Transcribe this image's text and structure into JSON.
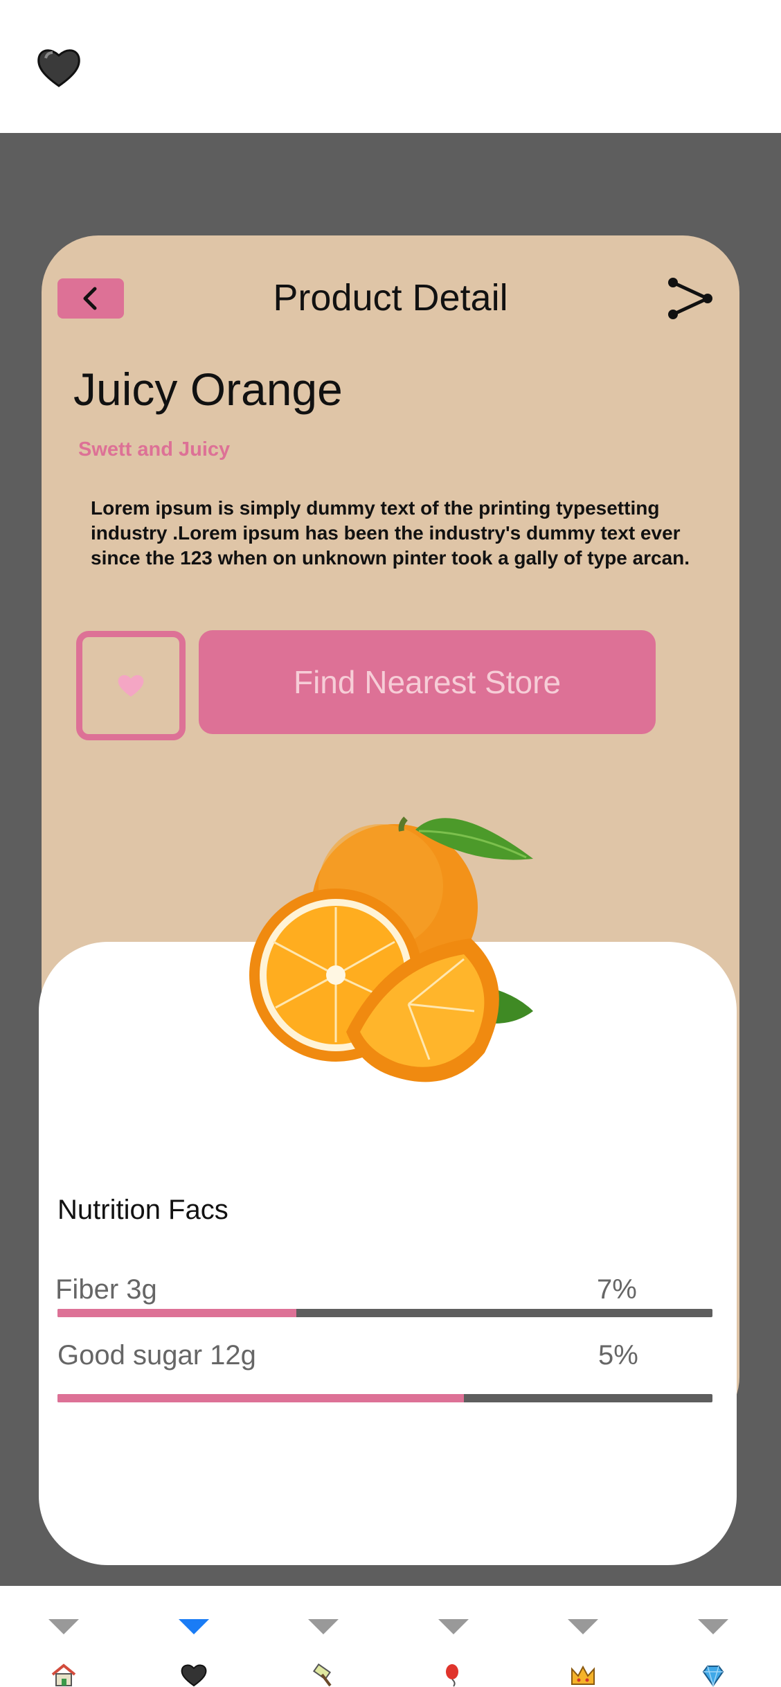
{
  "header": {
    "title": "Product Detail"
  },
  "product": {
    "name": "Juicy Orange",
    "subtitle": "Swett and Juicy",
    "description": "Lorem ipsum is simply dummy text of the printing typesetting industry .Lorem ipsum has been the industry's dummy text ever since the 123 when on unknown pinter took a gally of type arcan."
  },
  "actions": {
    "find_store_label": "Find Nearest Store"
  },
  "nutrition": {
    "title": "Nutrition Facs",
    "items": [
      {
        "name": "Fiber   3g",
        "percent_label": "7%",
        "bar_fill": 0.365
      },
      {
        "name": "Good sugar  12g",
        "percent_label": "5%",
        "bar_fill": 0.62
      }
    ]
  },
  "colors": {
    "accent": "#dd7196",
    "card": "#dfc5a7",
    "backdrop": "#5e5e5e",
    "active_nav": "#1a7cf5"
  },
  "nav": {
    "items": [
      {
        "icon": "home-icon",
        "active": false
      },
      {
        "icon": "heart-icon",
        "active": true
      },
      {
        "icon": "hammer-icon",
        "active": false
      },
      {
        "icon": "balloon-icon",
        "active": false
      },
      {
        "icon": "crown-icon",
        "active": false
      },
      {
        "icon": "gem-icon",
        "active": false
      }
    ]
  }
}
